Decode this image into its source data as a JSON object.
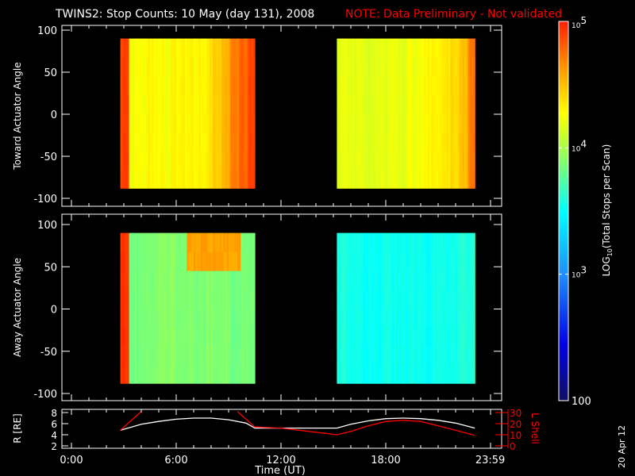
{
  "title": {
    "main": "TWINS2: Stop Counts: 10 May (day 131), 2008",
    "note": "NOTE: Data Preliminary - Not validated"
  },
  "date_stamp": "20 Apr 12",
  "colors": {
    "note": "#ff0000",
    "axes": "#ffffff",
    "lshell": "#ff0000",
    "radius": "#ffffff"
  },
  "chart_data": [
    {
      "type": "heatmap",
      "name": "toward",
      "ylabel": "Toward Actuator Angle",
      "ylim": [
        -110,
        110
      ],
      "yticks": [
        100,
        50,
        0,
        -50,
        -100
      ],
      "angle_range": [
        -88,
        90
      ],
      "segments": [
        {
          "start_hr": 2.8,
          "end_hr": 10.5,
          "log10_counts": [
            4.9,
            4.25,
            4.25,
            4.3,
            4.3,
            4.25,
            4.3,
            4.3,
            4.3,
            4.3,
            4.35,
            4.45,
            4.55,
            4.7,
            4.8,
            4.9
          ]
        },
        {
          "start_hr": 15.2,
          "end_hr": 23.1,
          "log10_counts": [
            4.2,
            4.2,
            4.2,
            4.15,
            4.2,
            4.2,
            4.2,
            4.2,
            4.25,
            4.25,
            4.3,
            4.3,
            4.35,
            4.4,
            4.5,
            4.7
          ]
        }
      ],
      "features": []
    },
    {
      "type": "heatmap",
      "name": "away",
      "ylabel": "Away Actuator Angle",
      "ylim": [
        -110,
        110
      ],
      "yticks": [
        100,
        50,
        0,
        -50,
        -100
      ],
      "angle_range": [
        -88,
        90
      ],
      "segments": [
        {
          "start_hr": 2.8,
          "end_hr": 10.5,
          "log10_counts": [
            4.95,
            3.85,
            3.85,
            3.85,
            3.9,
            3.9,
            3.9,
            3.85,
            3.9,
            3.85,
            3.9,
            3.9,
            3.9,
            3.85,
            3.85,
            3.85
          ]
        },
        {
          "start_hr": 15.2,
          "end_hr": 23.1,
          "log10_counts": [
            3.6,
            3.55,
            3.55,
            3.5,
            3.5,
            3.55,
            3.55,
            3.55,
            3.55,
            3.55,
            3.5,
            3.55,
            3.55,
            3.55,
            3.6,
            3.6
          ]
        }
      ],
      "features": [
        {
          "start_hr": 6.5,
          "end_hr": 9.6,
          "angle_min": 62,
          "angle_max": 90,
          "log10_counts": 4.6
        }
      ]
    },
    {
      "type": "line",
      "name": "orbit",
      "ylabel_left": "R [RE]",
      "ylabel_right": "L Shell",
      "ylim_left": [
        2,
        8
      ],
      "yticks_left": [
        8,
        6,
        4,
        2
      ],
      "ylim_right": [
        0,
        30
      ],
      "yticks_right": [
        30,
        20,
        10,
        0
      ],
      "series": [
        {
          "name": "R",
          "x": [
            2.8,
            4,
            5,
            6,
            7,
            8,
            9,
            10,
            10.5,
            15.2,
            16,
            17,
            18,
            19,
            20,
            21,
            22,
            23.1
          ],
          "y": [
            4.8,
            5.9,
            6.4,
            6.8,
            7.0,
            7.0,
            6.7,
            6.1,
            5.2,
            5.2,
            5.9,
            6.5,
            6.9,
            7.0,
            6.9,
            6.6,
            6.1,
            5.2
          ]
        },
        {
          "name": "L Shell",
          "segments": [
            {
              "x": [
                2.8,
                4.0
              ],
              "y": [
                14,
                31
              ]
            },
            {
              "x": [
                9.5,
                10.5,
                12,
                15.2,
                16,
                17,
                18,
                19,
                20,
                21,
                22,
                23.1
              ],
              "y": [
                31,
                17,
                16,
                10,
                13,
                18,
                22,
                23,
                22,
                18,
                14,
                9.5
              ]
            }
          ]
        }
      ]
    },
    {
      "type": "colorbar",
      "label": "LOG10(Total Stops per Scan)",
      "label_main": "LOG",
      "label_sub": "10",
      "label_rest": "(Total Stops per Scan)",
      "range_log10": [
        2,
        5
      ],
      "ticks": [
        {
          "base": "10",
          "exp": "5"
        },
        {
          "base": "10",
          "exp": "4"
        },
        {
          "base": "10",
          "exp": "3"
        },
        {
          "base": "100",
          "exp": ""
        }
      ]
    }
  ],
  "xaxis": {
    "label": "Time (UT)",
    "xlim_hr": [
      0,
      24
    ],
    "tick_labels": [
      "0:00",
      "6:00",
      "12:00",
      "18:00",
      "23:59"
    ],
    "tick_hr": [
      0,
      6,
      12,
      18,
      23.98
    ]
  }
}
